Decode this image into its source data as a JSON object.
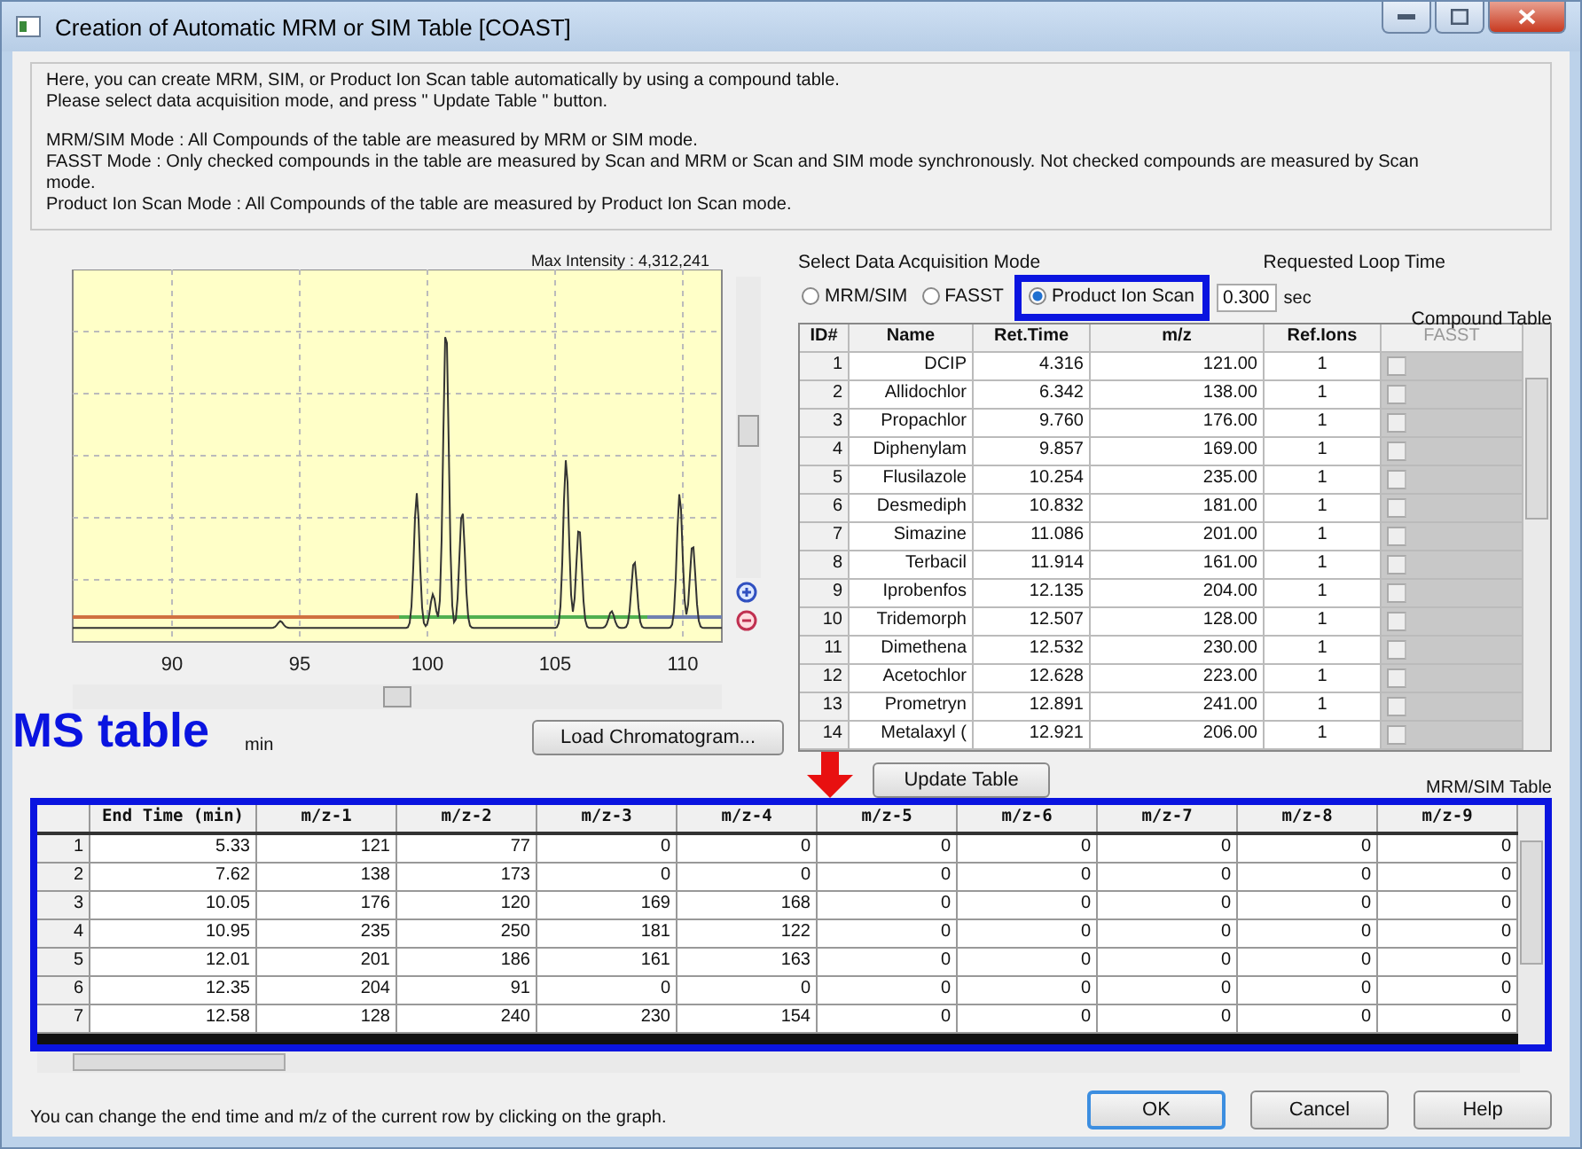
{
  "window": {
    "title": "Creation of Automatic MRM or SIM Table [COAST]"
  },
  "intro": [
    "Here, you can create MRM, SIM, or Product Ion Scan table automatically by using a compound table.",
    "Please select data acquisition mode, and press \" Update Table \" button."
  ],
  "mode_help": [
    "MRM/SIM Mode : All Compounds of the table are measured by MRM or SIM mode.",
    "FASST Mode : Only checked compounds in the table are measured by Scan and MRM or Scan and SIM mode synchronously. Not checked compounds are measured by Scan mode.",
    "Product Ion Scan Mode : All Compounds of the table are measured by Product Ion Scan mode."
  ],
  "chart": {
    "max_intensity": "Max Intensity : 4,312,241",
    "x_ticks": [
      "90",
      "95",
      "100",
      "105",
      "110"
    ]
  },
  "start_time": {
    "unit": "min"
  },
  "load_button": "Load Chromatogram...",
  "mode": {
    "label": "Select Data Acquisition Mode",
    "options": [
      {
        "label": "MRM/SIM",
        "selected": false,
        "highlighted": false
      },
      {
        "label": "FASST",
        "selected": false,
        "highlighted": false
      },
      {
        "label": "Product Ion Scan",
        "selected": true,
        "highlighted": true
      }
    ]
  },
  "loop_time": {
    "label": "Requested Loop Time",
    "value": "0.300",
    "unit": "sec"
  },
  "compound_table": {
    "title": "Compound Table",
    "columns": [
      {
        "label": "ID#",
        "disabled": false
      },
      {
        "label": "Name",
        "disabled": false
      },
      {
        "label": "Ret.Time",
        "disabled": false
      },
      {
        "label": "m/z",
        "disabled": false
      },
      {
        "label": "Ref.Ions",
        "disabled": false
      },
      {
        "label": "FASST",
        "disabled": true
      }
    ],
    "rows": [
      {
        "id": "1",
        "name": "DCIP",
        "ret_time": "4.316",
        "mz": "121.00",
        "ref_ions": "1",
        "fasst": false
      },
      {
        "id": "2",
        "name": "Allidochlor",
        "ret_time": "6.342",
        "mz": "138.00",
        "ref_ions": "1",
        "fasst": false
      },
      {
        "id": "3",
        "name": "Propachlor",
        "ret_time": "9.760",
        "mz": "176.00",
        "ref_ions": "1",
        "fasst": false
      },
      {
        "id": "4",
        "name": "Diphenylam",
        "ret_time": "9.857",
        "mz": "169.00",
        "ref_ions": "1",
        "fasst": false
      },
      {
        "id": "5",
        "name": "Flusilazole",
        "ret_time": "10.254",
        "mz": "235.00",
        "ref_ions": "1",
        "fasst": false
      },
      {
        "id": "6",
        "name": "Desmediph",
        "ret_time": "10.832",
        "mz": "181.00",
        "ref_ions": "1",
        "fasst": false
      },
      {
        "id": "7",
        "name": "Simazine",
        "ret_time": "11.086",
        "mz": "201.00",
        "ref_ions": "1",
        "fasst": false
      },
      {
        "id": "8",
        "name": "Terbacil",
        "ret_time": "11.914",
        "mz": "161.00",
        "ref_ions": "1",
        "fasst": false
      },
      {
        "id": "9",
        "name": "Iprobenfos",
        "ret_time": "12.135",
        "mz": "204.00",
        "ref_ions": "1",
        "fasst": false
      },
      {
        "id": "10",
        "name": "Tridemorph",
        "ret_time": "12.507",
        "mz": "128.00",
        "ref_ions": "1",
        "fasst": false
      },
      {
        "id": "11",
        "name": "Dimethena",
        "ret_time": "12.532",
        "mz": "230.00",
        "ref_ions": "1",
        "fasst": false
      },
      {
        "id": "12",
        "name": "Acetochlor",
        "ret_time": "12.628",
        "mz": "223.00",
        "ref_ions": "1",
        "fasst": false
      },
      {
        "id": "13",
        "name": "Prometryn",
        "ret_time": "12.891",
        "mz": "241.00",
        "ref_ions": "1",
        "fasst": false
      },
      {
        "id": "14",
        "name": "Metalaxyl (",
        "ret_time": "12.921",
        "mz": "206.00",
        "ref_ions": "1",
        "fasst": false
      }
    ]
  },
  "update_button": "Update Table",
  "ms_table": {
    "title": "MRM/SIM Table",
    "annotation": "MS table",
    "columns": [
      "End Time (min)",
      "m/z-1",
      "m/z-2",
      "m/z-3",
      "m/z-4",
      "m/z-5",
      "m/z-6",
      "m/z-7",
      "m/z-8",
      "m/z-9"
    ],
    "rows": [
      {
        "index": "1",
        "cells": [
          "5.33",
          "121",
          "77",
          "0",
          "0",
          "0",
          "0",
          "0",
          "0",
          "0"
        ]
      },
      {
        "index": "2",
        "cells": [
          "7.62",
          "138",
          "173",
          "0",
          "0",
          "0",
          "0",
          "0",
          "0",
          "0"
        ]
      },
      {
        "index": "3",
        "cells": [
          "10.05",
          "176",
          "120",
          "169",
          "168",
          "0",
          "0",
          "0",
          "0",
          "0"
        ]
      },
      {
        "index": "4",
        "cells": [
          "10.95",
          "235",
          "250",
          "181",
          "122",
          "0",
          "0",
          "0",
          "0",
          "0"
        ]
      },
      {
        "index": "5",
        "cells": [
          "12.01",
          "201",
          "186",
          "161",
          "163",
          "0",
          "0",
          "0",
          "0",
          "0"
        ]
      },
      {
        "index": "6",
        "cells": [
          "12.35",
          "204",
          "91",
          "0",
          "0",
          "0",
          "0",
          "0",
          "0",
          "0"
        ]
      },
      {
        "index": "7",
        "cells": [
          "12.58",
          "128",
          "240",
          "230",
          "154",
          "0",
          "0",
          "0",
          "0",
          "0"
        ]
      }
    ]
  },
  "footer_note": "You can change the end time and m/z of the current row by clicking on the graph.",
  "buttons": [
    {
      "label": "OK",
      "default": true
    },
    {
      "label": "Cancel",
      "default": false
    },
    {
      "label": "Help",
      "default": false
    }
  ]
}
